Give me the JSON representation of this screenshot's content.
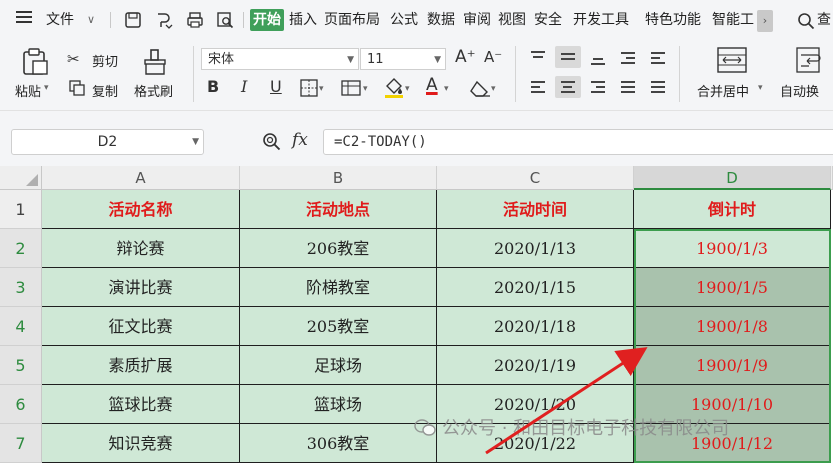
{
  "menubar": {
    "file_label": "文件",
    "tabs": [
      "开始",
      "插入",
      "页面布局",
      "公式",
      "数据",
      "审阅",
      "视图",
      "安全",
      "开发工具",
      "特色功能",
      "智能工"
    ],
    "search_label": "查"
  },
  "ribbon": {
    "paste_label": "粘贴",
    "cut_label": "剪切",
    "copy_label": "复制",
    "format_painter_label": "格式刷",
    "font_name": "宋体",
    "font_size": "11",
    "merge_label": "合并居中",
    "autowrap_label": "自动换",
    "bold_glyph": "B",
    "italic_glyph": "I",
    "underline_glyph": "U",
    "increase_font_glyph": "A⁺",
    "decrease_font_glyph": "A⁻",
    "font_color_glyph": "A"
  },
  "formula_bar": {
    "cell_ref": "D2",
    "fx_label": "fx",
    "formula": "=C2-TODAY()"
  },
  "sheet": {
    "columns": [
      "A",
      "B",
      "C",
      "D"
    ],
    "rows": [
      "1",
      "2",
      "3",
      "4",
      "5",
      "6",
      "7"
    ],
    "header": [
      "活动名称",
      "活动地点",
      "活动时间",
      "倒计时"
    ],
    "data": [
      [
        "辩论赛",
        "206教室",
        "2020/1/13",
        "1900/1/3"
      ],
      [
        "演讲比赛",
        "阶梯教室",
        "2020/1/15",
        "1900/1/5"
      ],
      [
        "征文比赛",
        "205教室",
        "2020/1/18",
        "1900/1/8"
      ],
      [
        "素质扩展",
        "足球场",
        "2020/1/19",
        "1900/1/9"
      ],
      [
        "篮球比赛",
        "篮球场",
        "2020/1/20",
        "1900/1/10"
      ],
      [
        "知识竞赛",
        "306教室",
        "2020/1/22",
        "1900/1/12"
      ]
    ]
  },
  "watermark": "公众号 · 和田目标电子科技有限公司",
  "colors": {
    "accent_green": "#3f9f5a",
    "cell_fill": "#cfe8d6",
    "header_red": "#e01b1b",
    "arrow_red": "#e02020"
  }
}
